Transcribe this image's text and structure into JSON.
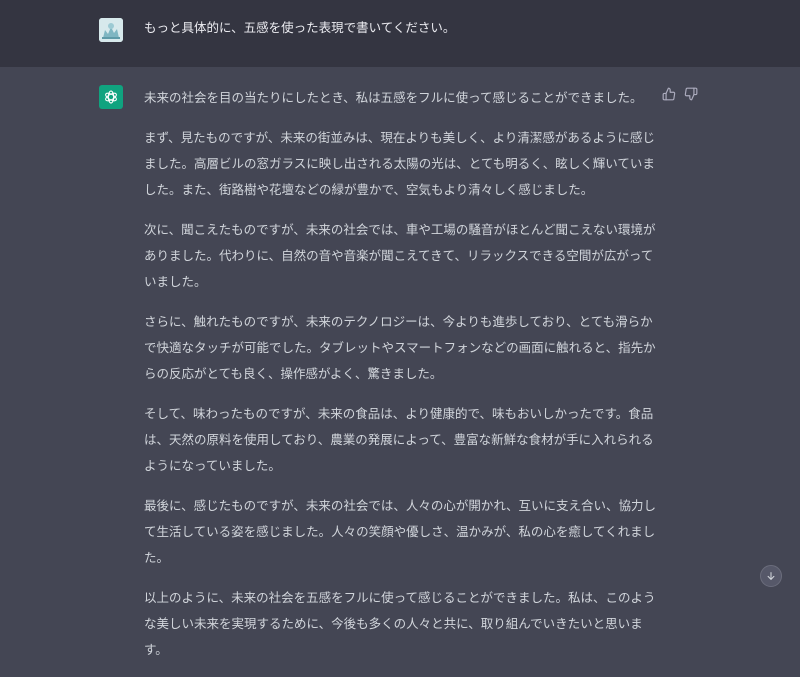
{
  "user_message": {
    "text": "もっと具体的に、五感を使った表現で書いてください。"
  },
  "assistant_message": {
    "paragraphs": [
      "未来の社会を目の当たりにしたとき、私は五感をフルに使って感じることができました。",
      "まず、見たものですが、未来の街並みは、現在よりも美しく、より清潔感があるように感じました。高層ビルの窓ガラスに映し出される太陽の光は、とても明るく、眩しく輝いていました。また、街路樹や花壇などの緑が豊かで、空気もより清々しく感じました。",
      "次に、聞こえたものですが、未来の社会では、車や工場の騒音がほとんど聞こえない環境がありました。代わりに、自然の音や音楽が聞こえてきて、リラックスできる空間が広がっていました。",
      "さらに、触れたものですが、未来のテクノロジーは、今よりも進歩しており、とても滑らかで快適なタッチが可能でした。タブレットやスマートフォンなどの画面に触れると、指先からの反応がとても良く、操作感がよく、驚きました。",
      "そして、味わったものですが、未来の食品は、より健康的で、味もおいしかったです。食品は、天然の原料を使用しており、農業の発展によって、豊富な新鮮な食材が手に入れられるようになっていました。",
      "最後に、感じたものですが、未来の社会では、人々の心が開かれ、互いに支え合い、協力して生活している姿を感じました。人々の笑顔や優しさ、温かみが、私の心を癒してくれました。",
      "以上のように、未来の社会を五感をフルに使って感じることができました。私は、このような美しい未来を実現するために、今後も多くの人々と共に、取り組んでいきたいと思います。"
    ]
  },
  "icons": {
    "user_avatar": "user-avatar-image",
    "assistant_avatar": "openai-logo-icon",
    "thumbs_up": "thumbs-up-icon",
    "thumbs_down": "thumbs-down-icon",
    "scroll_down": "arrow-down-icon"
  },
  "colors": {
    "user_bg": "#343541",
    "assistant_bg": "#444654",
    "brand": "#10a37f"
  }
}
